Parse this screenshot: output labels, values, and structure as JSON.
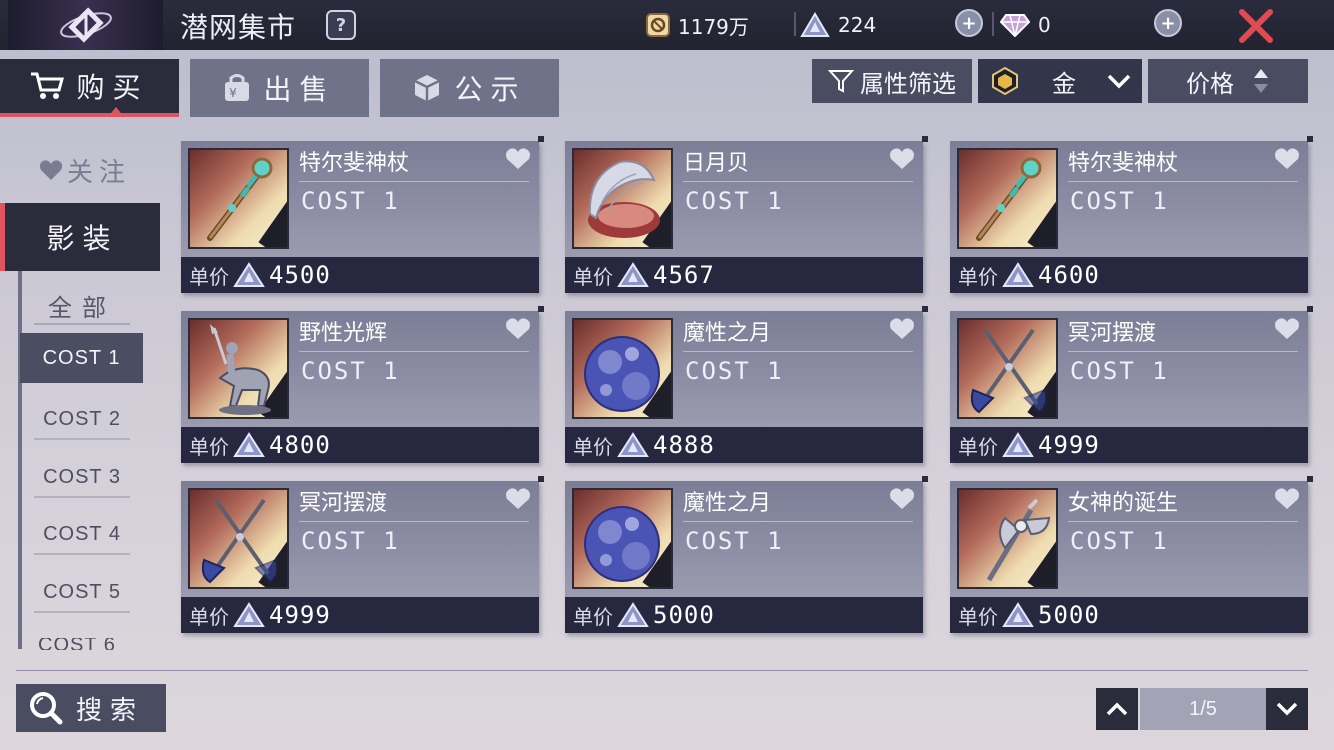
{
  "header": {
    "title": "潜网集市",
    "help_label": "?",
    "gold_amount": "1179万",
    "crystal_amount": "224",
    "diamond_amount": "0",
    "plus_label": "+"
  },
  "tabs": [
    {
      "label": "购买"
    },
    {
      "label": "出售"
    },
    {
      "label": "公示"
    }
  ],
  "toolbar": {
    "filter_label": "属性筛选",
    "metal_label": "金",
    "sort_label": "价格"
  },
  "sidebar": {
    "follow_label": "关注",
    "category_label": "影装",
    "all_label": "全部",
    "cost_items": [
      "COST 1",
      "COST 2",
      "COST 3",
      "COST 4",
      "COST 5",
      "COST 6"
    ]
  },
  "items": [
    {
      "name": "特尔斐神杖",
      "cost": "COST 1",
      "price_label": "单价",
      "price": "4500",
      "icon": "staff-icon"
    },
    {
      "name": "日月贝",
      "cost": "COST 1",
      "price_label": "单价",
      "price": "4567",
      "icon": "shell-icon"
    },
    {
      "name": "特尔斐神杖",
      "cost": "COST 1",
      "price_label": "单价",
      "price": "4600",
      "icon": "staff-icon"
    },
    {
      "name": "野性光辉",
      "cost": "COST 1",
      "price_label": "单价",
      "price": "4800",
      "icon": "centaur-icon"
    },
    {
      "name": "魔性之月",
      "cost": "COST 1",
      "price_label": "单价",
      "price": "4888",
      "icon": "moon-icon"
    },
    {
      "name": "冥河摆渡",
      "cost": "COST 1",
      "price_label": "单价",
      "price": "4999",
      "icon": "oars-icon"
    },
    {
      "name": "冥河摆渡",
      "cost": "COST 1",
      "price_label": "单价",
      "price": "4999",
      "icon": "oars-icon"
    },
    {
      "name": "魔性之月",
      "cost": "COST 1",
      "price_label": "单价",
      "price": "5000",
      "icon": "moon-icon"
    },
    {
      "name": "女神的诞生",
      "cost": "COST 1",
      "price_label": "单价",
      "price": "5000",
      "icon": "axe-icon"
    }
  ],
  "footer": {
    "search_label": "搜索",
    "page_indicator": "1/5"
  },
  "colors": {
    "accent": "#e0555d",
    "dark_panel": "#2a2b3b",
    "card_top": "#7c7e97"
  }
}
